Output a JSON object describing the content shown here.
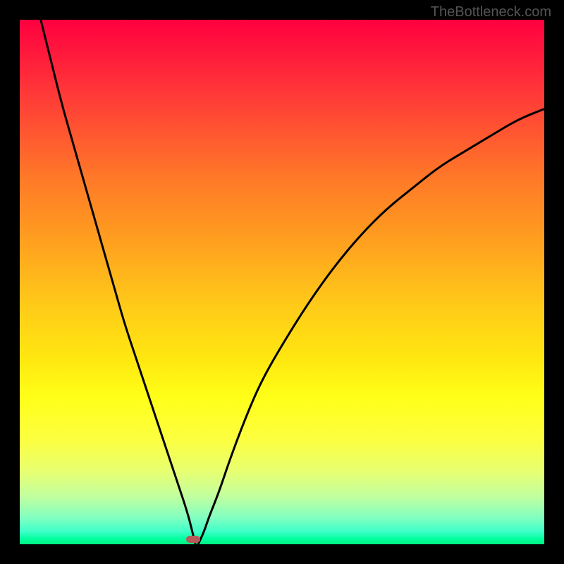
{
  "watermark": "TheBottleneck.com",
  "chart_data": {
    "type": "line",
    "title": "",
    "xlabel": "",
    "ylabel": "",
    "x_range": [
      0,
      100
    ],
    "y_range": [
      0,
      100
    ],
    "left_branch": {
      "x": [
        4,
        6,
        8,
        10,
        12,
        14,
        16,
        18,
        20,
        22,
        24,
        26,
        28,
        30,
        32,
        33,
        33.5
      ],
      "y": [
        100,
        92,
        84,
        77,
        70,
        63,
        56,
        49,
        42,
        36,
        30,
        24,
        18,
        12,
        6,
        2,
        0
      ]
    },
    "right_branch": {
      "x": [
        34,
        35,
        36,
        38,
        40,
        43,
        46,
        50,
        55,
        60,
        65,
        70,
        75,
        80,
        85,
        90,
        95,
        100
      ],
      "y": [
        0,
        2,
        5,
        10,
        16,
        24,
        31,
        38,
        46,
        53,
        59,
        64,
        68,
        72,
        75,
        78,
        81,
        83
      ]
    },
    "marker": {
      "x": 33,
      "y": 1,
      "color": "#b85a5a"
    },
    "background_gradient": {
      "top": "#ff0040",
      "bottom": "#00f080",
      "description": "vertical gradient red to green through orange and yellow"
    }
  }
}
